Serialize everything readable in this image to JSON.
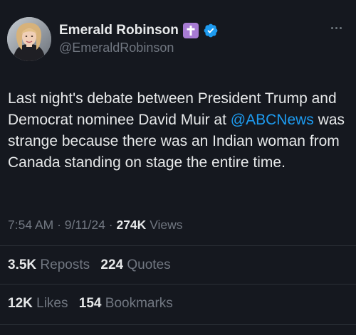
{
  "tweet": {
    "author": {
      "display_name": "Emerald Robinson",
      "handle": "@EmeraldRobinson",
      "badge_icon": "latin-cross-icon",
      "badge_color": "#a77bd3",
      "verified_icon": "verified-badge-icon",
      "verified_color": "#1d9bf0"
    },
    "text_parts": {
      "before_mention": "Last night's debate between President Trump and Democrat nominee David Muir at ",
      "mention": "@ABCNews",
      "after_mention": " was strange because there was an Indian woman from Canada standing on stage the entire time."
    },
    "meta": {
      "time": "7:54 AM",
      "separator": "·",
      "date": "9/11/24",
      "views_count": "274K",
      "views_label": "Views"
    },
    "stats": {
      "reposts_count": "3.5K",
      "reposts_label": "Reposts",
      "quotes_count": "224",
      "quotes_label": "Quotes",
      "likes_count": "12K",
      "likes_label": "Likes",
      "bookmarks_count": "154",
      "bookmarks_label": "Bookmarks"
    }
  },
  "colors": {
    "background": "#15181f",
    "text_primary": "#e7e9ea",
    "text_secondary": "#717781",
    "link": "#1d9bf0",
    "divider": "#2b3037"
  }
}
